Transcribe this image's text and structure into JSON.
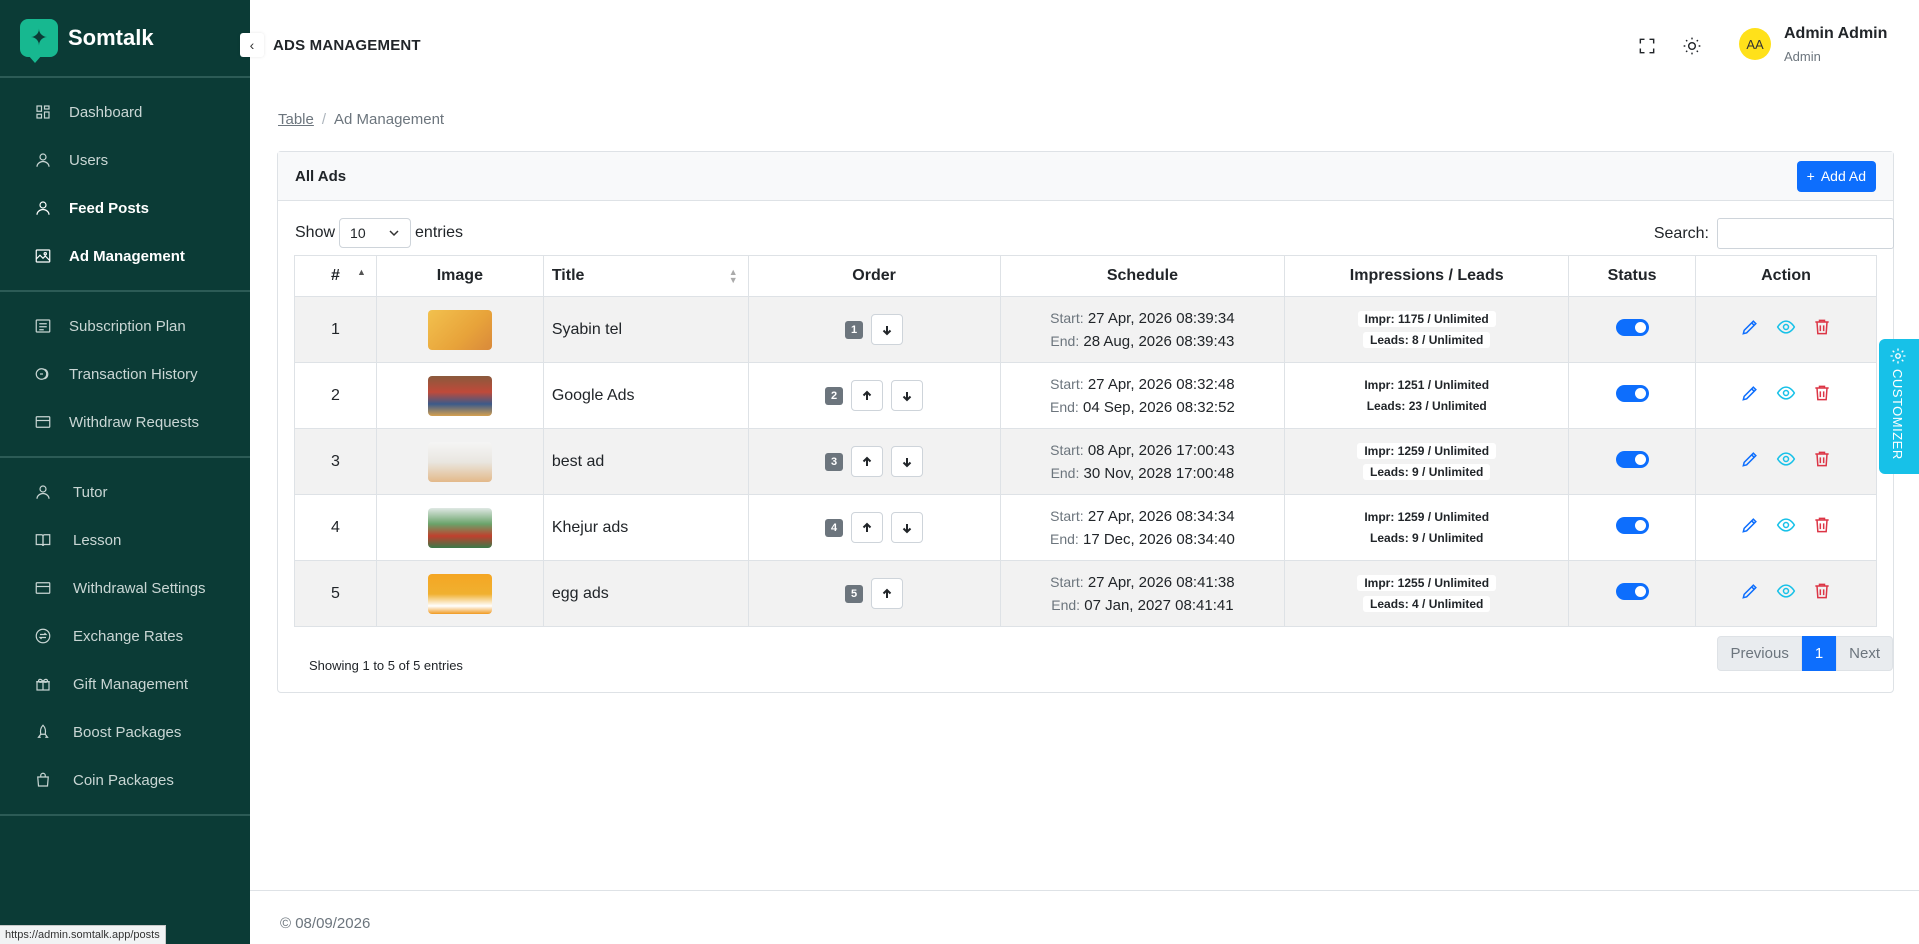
{
  "brand": {
    "name": "Somtalk",
    "logo_glyph": "✦"
  },
  "sidebar": {
    "groups": [
      [
        {
          "label": "Dashboard",
          "icon": "dashboard-icon",
          "active": false
        },
        {
          "label": "Users",
          "icon": "user-icon",
          "active": false
        },
        {
          "label": "Feed Posts",
          "icon": "user-icon",
          "active": true
        },
        {
          "label": "Ad Management",
          "icon": "image-icon",
          "active": true
        }
      ],
      [
        {
          "label": "Subscription Plan",
          "icon": "list-icon"
        },
        {
          "label": "Transaction History",
          "icon": "coins-icon"
        },
        {
          "label": "Withdraw Requests",
          "icon": "card-icon"
        }
      ],
      [
        {
          "label": "Tutor",
          "icon": "user-icon"
        },
        {
          "label": "Lesson",
          "icon": "book-icon"
        },
        {
          "label": "Withdrawal Settings",
          "icon": "card-icon"
        },
        {
          "label": "Exchange Rates",
          "icon": "exchange-icon"
        },
        {
          "label": "Gift Management",
          "icon": "gift-icon"
        },
        {
          "label": "Boost Packages",
          "icon": "rocket-icon"
        },
        {
          "label": "Coin Packages",
          "icon": "bag-icon"
        }
      ]
    ]
  },
  "status_url": "https://admin.somtalk.app/posts",
  "header": {
    "collapse_glyph": "‹",
    "title": "ADS MANAGEMENT",
    "user_initials": "AA",
    "user_name": "Admin Admin",
    "user_role": "Admin"
  },
  "breadcrumb": {
    "link": "Table",
    "separator": "/",
    "current": "Ad Management"
  },
  "card": {
    "title": "All Ads",
    "add_button": "Add Ad",
    "add_glyph": "+"
  },
  "controls": {
    "show_label": "Show",
    "entries_value": "10",
    "entries_label": "entries",
    "search_label": "Search:"
  },
  "table": {
    "headers": [
      "#",
      "Image",
      "Title",
      "Order",
      "Schedule",
      "Impressions / Leads",
      "Status",
      "Action"
    ],
    "start_label": "Start:",
    "end_label": "End:",
    "rows": [
      {
        "num": "1",
        "title": "Syabin tel",
        "order": "1",
        "up": false,
        "down": true,
        "start": "27 Apr, 2026 08:39:34",
        "end": "28 Aug, 2026 08:39:43",
        "impr": "Impr: 1175 / Unlimited",
        "leads": "Leads: 8 / Unlimited",
        "status": true,
        "thumb": "linear-gradient(135deg,#f2c14e,#e8a33a 60%,#d9893a)"
      },
      {
        "num": "2",
        "title": "Google Ads",
        "order": "2",
        "up": true,
        "down": true,
        "start": "27 Apr, 2026 08:32:48",
        "end": "04 Sep, 2026 08:32:52",
        "impr": "Impr: 1251 / Unlimited",
        "leads": "Leads: 23 / Unlimited",
        "status": true,
        "thumb": "linear-gradient(180deg,#8a5a3c,#c04a3a 40%,#3b5a8a 70%,#d4a050)"
      },
      {
        "num": "3",
        "title": "best ad",
        "order": "3",
        "up": true,
        "down": true,
        "start": "08 Apr, 2026 17:00:43",
        "end": "30 Nov, 2028 17:00:48",
        "impr": "Impr: 1259 / Unlimited",
        "leads": "Leads: 9 / Unlimited",
        "status": true,
        "thumb": "linear-gradient(180deg,#f5f5f5,#e9e6e0 50%,#e3b98a)"
      },
      {
        "num": "4",
        "title": "Khejur ads",
        "order": "4",
        "up": true,
        "down": true,
        "start": "27 Apr, 2026 08:34:34",
        "end": "17 Dec, 2026 08:34:40",
        "impr": "Impr: 1259 / Unlimited",
        "leads": "Leads: 9 / Unlimited",
        "status": true,
        "thumb": "linear-gradient(180deg,#dfe8e4,#6aa36a 40%,#c0402e 70%,#3a7a4a)"
      },
      {
        "num": "5",
        "title": "egg ads",
        "order": "5",
        "up": true,
        "down": false,
        "start": "27 Apr, 2026 08:41:38",
        "end": "07 Jan, 2027 08:41:41",
        "impr": "Impr: 1255 / Unlimited",
        "leads": "Leads: 4 / Unlimited",
        "status": true,
        "thumb": "linear-gradient(180deg,#f5a623,#f0b030 50%,#ffffff 80%,#f09a20)"
      }
    ]
  },
  "pagination": {
    "info": "Showing 1 to 5 of 5 entries",
    "previous": "Previous",
    "current": "1",
    "next": "Next"
  },
  "customizer": {
    "label": "CUSTOMIZER"
  },
  "footer": {
    "text": "© 08/09/2026"
  },
  "colors": {
    "sidebar_bg": "#0b3b36",
    "primary": "#0d6efd",
    "accent": "#17b890",
    "info": "#17c1e8",
    "danger": "#dc3545"
  }
}
